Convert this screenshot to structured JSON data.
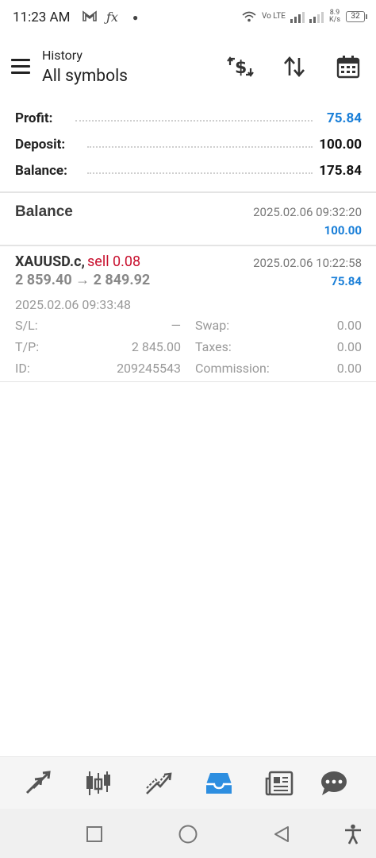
{
  "status_bar": {
    "time": "11:23 AM",
    "icons": [
      "gmail-icon",
      "fx-icon",
      "dot-icon"
    ],
    "network": "Vo LTE",
    "speed": "8.9 K/s",
    "battery": "32"
  },
  "header": {
    "subtitle": "History",
    "title": "All symbols",
    "actions": [
      "currency-exchange-icon",
      "sort-icon",
      "calendar-icon"
    ]
  },
  "summary": {
    "rows": [
      {
        "label": "Profit:",
        "value": "75.84"
      },
      {
        "label": "Deposit:",
        "value": "100.00"
      },
      {
        "label": "Balance:",
        "value": "175.84"
      }
    ]
  },
  "balance_entry": {
    "title": "Balance",
    "datetime": "2025.02.06 09:32:20",
    "amount": "100.00"
  },
  "deal": {
    "symbol": "XAUUSD.c,",
    "side": "sell 0.08",
    "open_datetime": "2025.02.06 10:22:58",
    "prices": "2 859.40 → 2 849.92",
    "profit": "75.84",
    "close_datetime": "2025.02.06 09:33:48",
    "details": {
      "sl_label": "S/L:",
      "sl_value": "—",
      "tp_label": "T/P:",
      "tp_value": "2 845.00",
      "id_label": "ID:",
      "id_value": "209245543",
      "swap_label": "Swap:",
      "swap_value": "0.00",
      "taxes_label": "Taxes:",
      "taxes_value": "0.00",
      "commission_label": "Commission:",
      "commission_value": "0.00"
    }
  },
  "bottom_nav": {
    "items": [
      "trade-arrows-icon",
      "candlestick-chart-icon",
      "trade-line-icon",
      "history-inbox-icon",
      "news-icon",
      "chat-icon"
    ],
    "active": "history-inbox-icon"
  },
  "colors": {
    "accent": "#1a7fd8",
    "sell": "#c8102e"
  }
}
